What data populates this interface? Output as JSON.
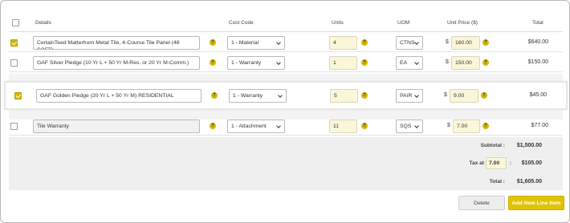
{
  "header": {
    "details": "Details",
    "cost_code": "Cost Code",
    "units": "Units",
    "uom": "UOM",
    "unit_price": "Unit Price ($)",
    "total": "Total"
  },
  "info_glyph": "?",
  "currency": "$",
  "rows": [
    {
      "checked": true,
      "details": "CertainTeed Matterhorn Metal Tile, 4-Course Tile Panel (48 SQFT) ",
      "cost_code": "1 - Material",
      "units": "4",
      "uom": "CTNS",
      "unit_price": "160.00",
      "total": "$640.00"
    },
    {
      "checked": false,
      "details": "GAF Silver Pledge (10 Yr L + 50 Yr M-Res. or 20 Yr M-Comm.)",
      "cost_code": "1 - Warranty",
      "units": "1",
      "uom": "EA",
      "unit_price": "150.00",
      "total": "$150.00"
    },
    {
      "checked": true,
      "details": "GAF Golden Pledge (20 Yr L + 50 Yr M) RESIDENTIAL",
      "cost_code": "1 - Warranty",
      "units": "5",
      "uom": "PAIR",
      "unit_price": "9.00",
      "total": "$45.00"
    },
    {
      "checked": false,
      "details": "Tile Warranty",
      "cost_code": "1 - Attachment",
      "units": "11",
      "uom": "SQS",
      "unit_price": "7.00",
      "total": "$77.00"
    }
  ],
  "summary": {
    "subtotal_label": "Subtotal :",
    "subtotal_value": "$1,500.00",
    "tax_label": "Tax at",
    "tax_rate": "7.00",
    "tax_sep": ":",
    "tax_value": "$105.00",
    "total_label": "Total :",
    "total_value": "$1,605.00"
  },
  "buttons": {
    "delete": "Delete",
    "add": "Add New Line Item"
  },
  "colors": {
    "accent": "#d4b800",
    "button_accent": "#e1c400",
    "field_highlight": "#fcf6d9"
  }
}
